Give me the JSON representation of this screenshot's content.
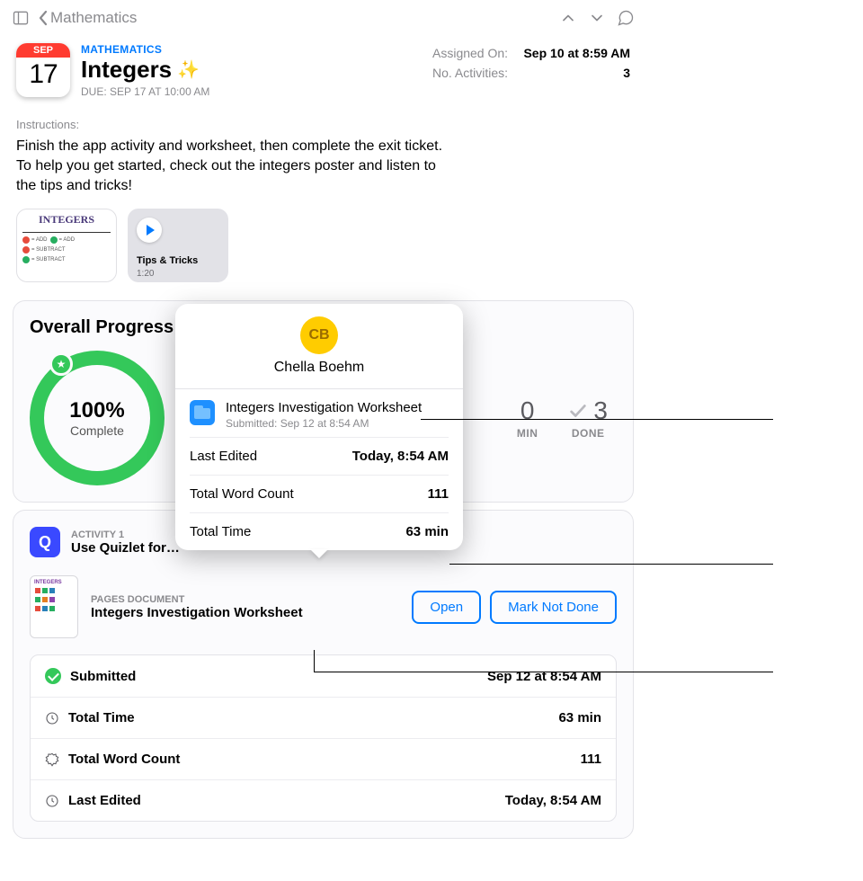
{
  "nav": {
    "back_label": "Mathematics"
  },
  "header": {
    "cal_month": "SEP",
    "cal_day": "17",
    "subject": "MATHEMATICS",
    "title": "Integers",
    "due": "DUE: SEP 17 AT 10:00 AM",
    "meta": {
      "assigned_label": "Assigned On:",
      "assigned_value": "Sep 10 at 8:59 AM",
      "activities_label": "No. Activities:",
      "activities_value": "3"
    }
  },
  "instructions_label": "Instructions:",
  "instructions_text": "Finish the app activity and worksheet, then complete the exit ticket. To help you get started, check out the integers poster and listen to the tips and tricks!",
  "attachments": {
    "poster_title": "INTEGERS",
    "media_title": "Tips & Tricks",
    "media_duration": "1:20"
  },
  "progress": {
    "heading": "Overall Progress",
    "percent_label": "100%",
    "complete_label": "Complete",
    "stats": {
      "min_value": "0",
      "min_label": "MIN",
      "done_value": "3",
      "done_label": "DONE"
    }
  },
  "activity": {
    "type_label": "ACTIVITY 1",
    "name_trunc": "Use Quizlet for…",
    "doc_type_label": "PAGES DOCUMENT",
    "doc_name": "Integers Investigation Worksheet",
    "open_label": "Open",
    "mark_label": "Mark Not Done",
    "details": {
      "submitted_label": "Submitted",
      "submitted_value": "Sep 12 at 8:54 AM",
      "total_time_label": "Total Time",
      "total_time_value": "63 min",
      "word_count_label": "Total Word Count",
      "word_count_value": "111",
      "last_edited_label": "Last Edited",
      "last_edited_value": "Today, 8:54 AM"
    }
  },
  "popover": {
    "initials": "CB",
    "student_name": "Chella Boehm",
    "file_title": "Integers Investigation Worksheet",
    "file_sub": "Submitted: Sep 12 at 8:54 AM",
    "rows": {
      "last_edited_label": "Last Edited",
      "last_edited_value": "Today, 8:54 AM",
      "word_count_label": "Total Word Count",
      "word_count_value": "111",
      "total_time_label": "Total Time",
      "total_time_value": "63 min"
    }
  }
}
